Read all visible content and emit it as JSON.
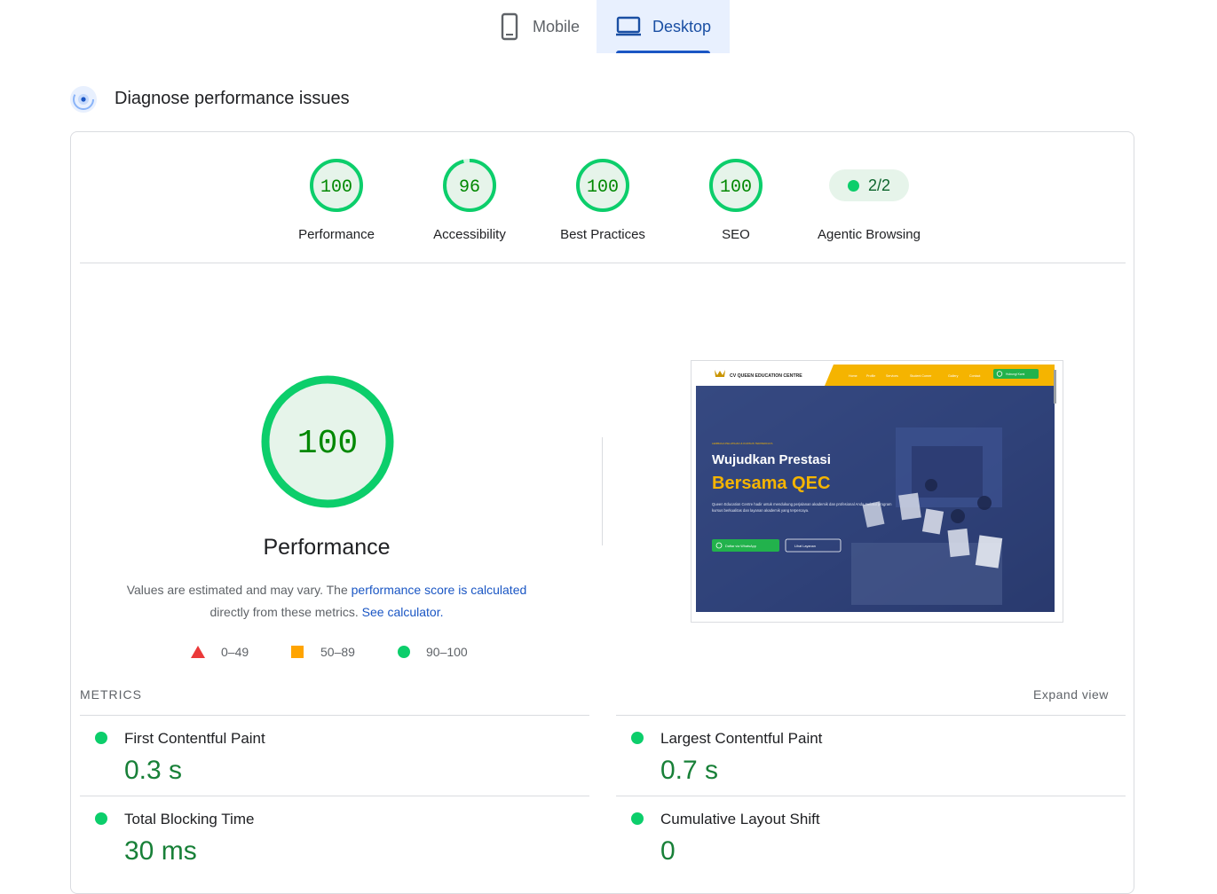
{
  "tabs": [
    {
      "label": "Mobile",
      "active": false
    },
    {
      "label": "Desktop",
      "active": true
    }
  ],
  "section_title": "Diagnose performance issues",
  "categories": [
    {
      "score": "100",
      "label": "Performance"
    },
    {
      "score": "96",
      "label": "Accessibility"
    },
    {
      "score": "100",
      "label": "Best Practices"
    },
    {
      "score": "100",
      "label": "SEO"
    }
  ],
  "agentic": {
    "value": "2/2",
    "label": "Agentic Browsing"
  },
  "performance": {
    "score": "100",
    "label": "Performance",
    "note_prefix": "Values are estimated and may vary. The ",
    "note_link1": "performance score is calculated",
    "note_middle": "directly from these metrics. ",
    "note_link2": "See calculator."
  },
  "legend": [
    {
      "range": "0–49",
      "icon": "triangle-icon",
      "color": "#eb3939"
    },
    {
      "range": "50–89",
      "icon": "square-icon",
      "color": "#ffa400"
    },
    {
      "range": "90–100",
      "icon": "circle-icon",
      "color": "#0cce6b"
    }
  ],
  "metrics_header": "METRICS",
  "expand_label": "Expand view",
  "metrics": [
    {
      "name": "First Contentful Paint",
      "value": "0.3 s"
    },
    {
      "name": "Largest Contentful Paint",
      "value": "0.7 s"
    },
    {
      "name": "Total Blocking Time",
      "value": "30 ms"
    },
    {
      "name": "Cumulative Layout Shift",
      "value": "0"
    }
  ],
  "screenshot": {
    "brand": "CV QUEEN EDUCATION CENTRE",
    "nav": [
      "Home",
      "Profile",
      "Services",
      "Student Corner",
      "Gallery",
      "Contact"
    ],
    "nav_button": "Hubungi Kami",
    "eyebrow": "LEMBAGA PELATIHAN & KURSUS TERPERCAYA",
    "headline1": "Wujudkan Prestasi",
    "headline2": "Bersama QEC",
    "body": "Queen Education Centre hadir untuk mendukung perjalanan akademik dan profesional Anda melalui program kursus berkualitas dan layanan akademik yang terpercaya.",
    "btn1": "Daftar via WhatsApp",
    "btn2": "Lihat Layanan"
  },
  "colors": {
    "good": "#0cce6b",
    "good_bg": "#e6f4ea",
    "good_text": "#008800",
    "accent": "#1a56c4",
    "yellow": "#f5b400"
  }
}
